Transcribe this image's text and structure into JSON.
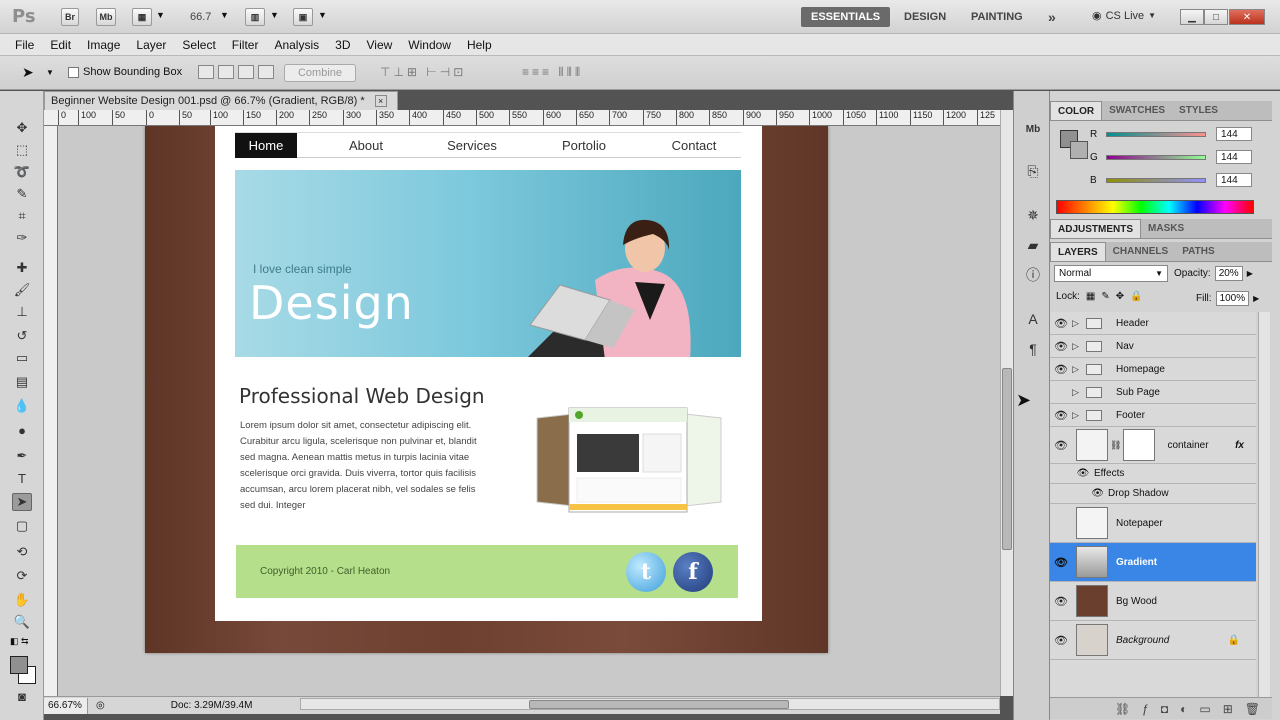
{
  "appbar": {
    "logo": "Ps",
    "br": "Br",
    "mb": "Mb",
    "zoom": "66.7",
    "workspaces": [
      "ESSENTIALS",
      "DESIGN",
      "PAINTING"
    ],
    "more": "»",
    "cs_live": "CS Live"
  },
  "menu": [
    "File",
    "Edit",
    "Image",
    "Layer",
    "Select",
    "Filter",
    "Analysis",
    "3D",
    "View",
    "Window",
    "Help"
  ],
  "options": {
    "show_bounding_box": "Show Bounding Box",
    "combine": "Combine"
  },
  "document": {
    "tab_title": "Beginner Website Design 001.psd @ 66.7% (Gradient, RGB/8) *",
    "close": "×",
    "ruler_ticks": [
      "0",
      "100",
      "50",
      "0",
      "50",
      "100",
      "150",
      "200",
      "250",
      "300",
      "350",
      "400",
      "450",
      "500",
      "550",
      "600",
      "650",
      "700",
      "750",
      "800",
      "850",
      "900",
      "950",
      "1000",
      "1050",
      "1100",
      "1150",
      "1200",
      "125"
    ]
  },
  "website": {
    "nav": [
      "Home",
      "About",
      "Services",
      "Portolio",
      "Contact"
    ],
    "banner_tagline": "I love clean simple",
    "banner_title": "Design",
    "content_title": "Professional Web Design",
    "lorem": "Lorem ipsum dolor sit amet, consectetur adipiscing elit. Curabitur arcu ligula, scelerisque non pulvinar et, blandit sed magna. Aenean mattis metus in turpis lacinia vitae scelerisque orci gravida. Duis viverra, tortor quis facilisis accumsan, arcu lorem placerat nibh, vel sodales se felis sed dui. Integer",
    "copyright": "Copyright 2010 - Carl Heaton",
    "twitter": "t",
    "facebook": "f"
  },
  "status": {
    "zoom": "66.67%",
    "doc": "Doc: 3.29M/39.4M"
  },
  "color_panel": {
    "tabs": [
      "COLOR",
      "SWATCHES",
      "STYLES"
    ],
    "channels": [
      {
        "label": "R",
        "value": "144"
      },
      {
        "label": "G",
        "value": "144"
      },
      {
        "label": "B",
        "value": "144"
      }
    ]
  },
  "adjust_panel": {
    "tabs": [
      "ADJUSTMENTS",
      "MASKS"
    ]
  },
  "layers_panel": {
    "tabs": [
      "LAYERS",
      "CHANNELS",
      "PATHS"
    ],
    "blend_mode": "Normal",
    "opacity_label": "Opacity:",
    "opacity": "20%",
    "lock_label": "Lock:",
    "fill_label": "Fill:",
    "fill": "100%",
    "groups": [
      "Header",
      "Nav",
      "Homepage",
      "Sub Page",
      "Footer"
    ],
    "container": "container",
    "fx": "fx",
    "effects": "Effects",
    "drop_shadow": "Drop Shadow",
    "layers": [
      "Notepaper",
      "Gradient",
      "Bg Wood",
      "Background"
    ]
  }
}
